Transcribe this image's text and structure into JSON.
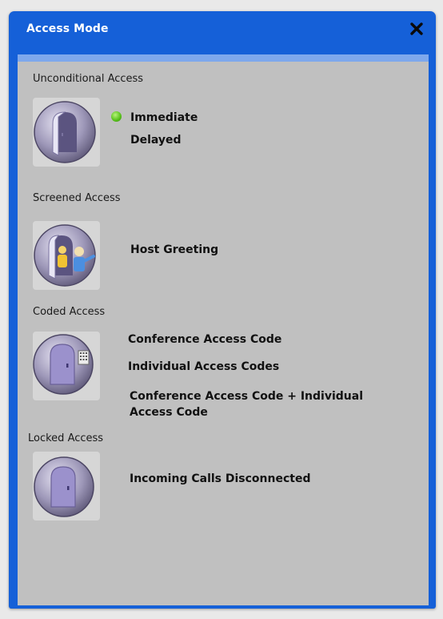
{
  "dialog": {
    "title": "Access Mode",
    "close_symbol": "✕",
    "accent_color": "#1560d8"
  },
  "sections": [
    {
      "label": "Unconditional Access",
      "icon": "open-door-icon",
      "options": [
        {
          "label": "Immediate",
          "selected": true
        },
        {
          "label": "Delayed",
          "selected": false
        }
      ]
    },
    {
      "label": "Screened Access",
      "icon": "host-greeting-door-icon",
      "options": [
        {
          "label": "Host Greeting",
          "selected": false
        }
      ]
    },
    {
      "label": "Coded Access",
      "icon": "door-keypad-icon",
      "options": [
        {
          "label": "Conference Access Code",
          "selected": false
        },
        {
          "label": "Individual Access Codes",
          "selected": false
        },
        {
          "label": "Conference Access Code + Individual Access Code",
          "selected": false
        }
      ]
    },
    {
      "label": "Locked Access",
      "icon": "closed-door-icon",
      "options": [
        {
          "label": "Incoming Calls Disconnected",
          "selected": false
        }
      ]
    }
  ]
}
